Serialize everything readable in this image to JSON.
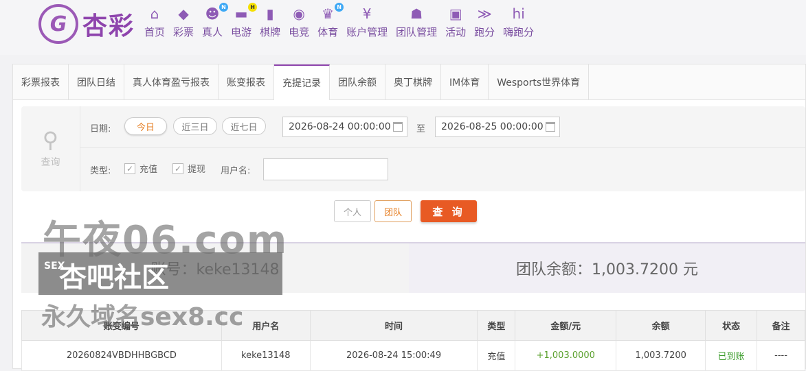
{
  "brand": {
    "logo_text": "杏彩",
    "logo_mark": "G"
  },
  "nav": [
    {
      "label": "首页",
      "icon": "home-icon",
      "glyph": "⌂"
    },
    {
      "label": "彩票",
      "icon": "ticket-icon",
      "glyph": "◆"
    },
    {
      "label": "真人",
      "icon": "dealer-icon",
      "glyph": "☻",
      "badge": "N"
    },
    {
      "label": "电游",
      "icon": "gamepad-icon",
      "glyph": "▬",
      "badge": "H"
    },
    {
      "label": "棋牌",
      "icon": "cards-icon",
      "glyph": "▮"
    },
    {
      "label": "电竞",
      "icon": "controller-icon",
      "glyph": "◉"
    },
    {
      "label": "体育",
      "icon": "trophy-icon",
      "glyph": "♛",
      "badge": "N"
    },
    {
      "label": "账户管理",
      "icon": "yen-coin-icon",
      "glyph": "¥"
    },
    {
      "label": "团队管理",
      "icon": "team-icon",
      "glyph": "☗"
    },
    {
      "label": "活动",
      "icon": "gift-icon",
      "glyph": "▣"
    },
    {
      "label": "跑分",
      "icon": "running-icon",
      "glyph": "≫"
    },
    {
      "label": "嗨跑分",
      "icon": "hi-icon",
      "glyph": "hi"
    }
  ],
  "tabs": [
    {
      "label": "彩票报表",
      "active": false
    },
    {
      "label": "团队日结",
      "active": false
    },
    {
      "label": "真人体育盈亏报表",
      "active": false
    },
    {
      "label": "账变报表",
      "active": false
    },
    {
      "label": "充提记录",
      "active": true
    },
    {
      "label": "团队余额",
      "active": false
    },
    {
      "label": "奥丁棋牌",
      "active": false
    },
    {
      "label": "IM体育",
      "active": false
    },
    {
      "label": "Wesports世界体育",
      "active": false
    }
  ],
  "filter": {
    "search_label": "查询",
    "date_label": "日期:",
    "quick": [
      "今日",
      "近三日",
      "近七日"
    ],
    "start": "2026-08-24 00:00:00",
    "to_label": "至",
    "end": "2026-08-25 00:00:00",
    "type_label": "类型:",
    "types": [
      "充值",
      "提现"
    ],
    "user_label": "用户名:",
    "user_value": ""
  },
  "actions": {
    "personal": "个人",
    "team": "团队",
    "query": "查 询"
  },
  "summary": {
    "account": "账号：keke13148",
    "team_balance": "团队余额：1,003.7200 元"
  },
  "table": {
    "headers": [
      "账变编号",
      "用户名",
      "时间",
      "类型",
      "金额/元",
      "余额",
      "状态",
      "备注"
    ],
    "rows": [
      [
        "20260824VBDHHBGBCD",
        "keke13148",
        "2026-08-24 15:00:49",
        "充值",
        "+1,003.0000",
        "1,003.7200",
        "已到账",
        "----"
      ]
    ]
  },
  "watermark": {
    "line1": "午夜06.com",
    "tag": "SEX",
    "line2": "杏吧社区",
    "line3": "永久域名sex8.cc"
  },
  "colors": {
    "brand": "#8e44ad",
    "accent": "#e67e22",
    "query_btn": "#e85a24",
    "success": "#3a9c2a"
  }
}
